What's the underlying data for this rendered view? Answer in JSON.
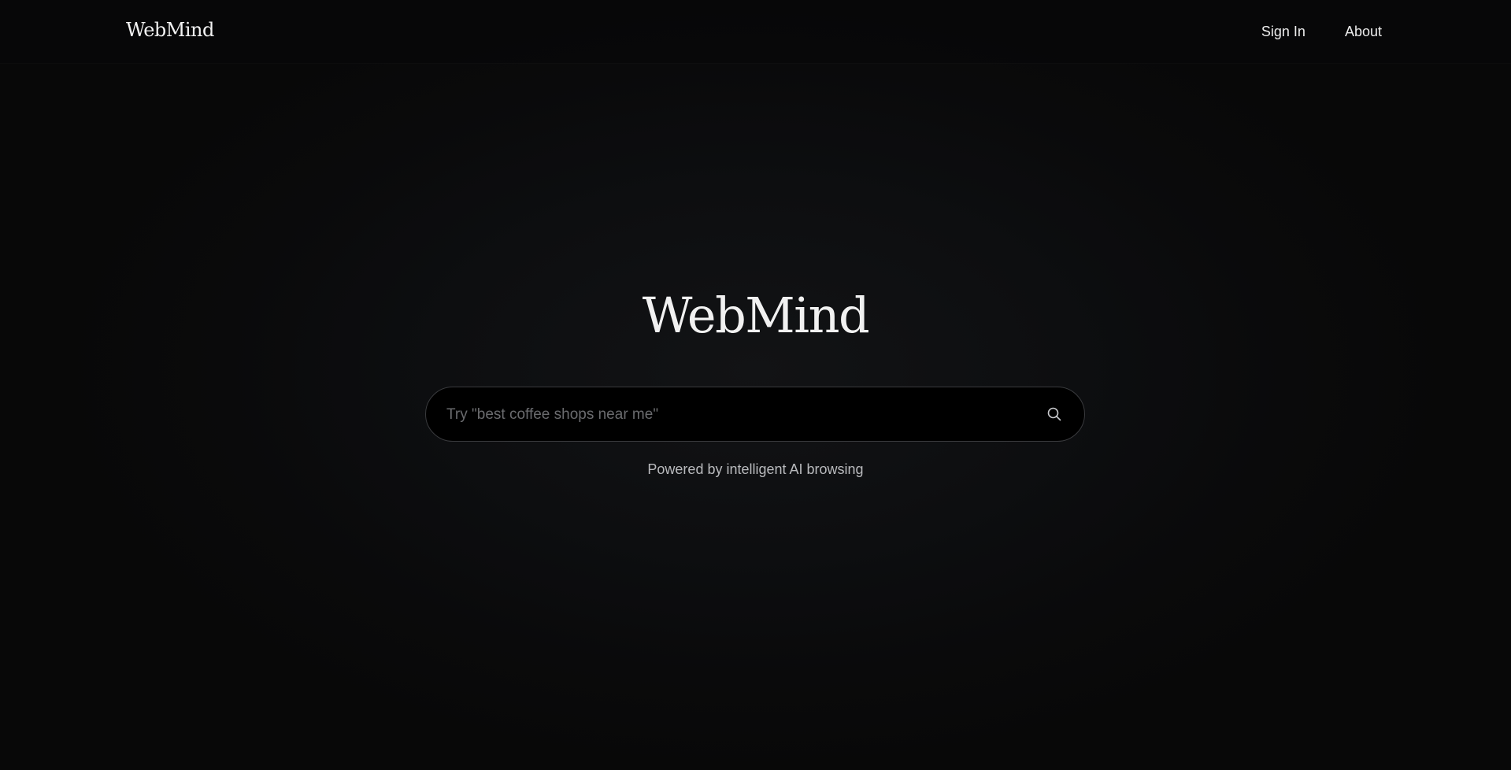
{
  "header": {
    "brand": "WebMind",
    "nav": {
      "sign_in": "Sign In",
      "about": "About"
    }
  },
  "hero": {
    "title": "WebMind",
    "search": {
      "value": "",
      "placeholder": "Try \"best coffee shops near me\"",
      "icon": "search-icon"
    },
    "tagline": "Powered by intelligent AI browsing"
  },
  "colors": {
    "background": "#0b0b0c",
    "text": "#f1f1f1",
    "muted": "#b9babd",
    "search_border": "#3a3b3e"
  }
}
